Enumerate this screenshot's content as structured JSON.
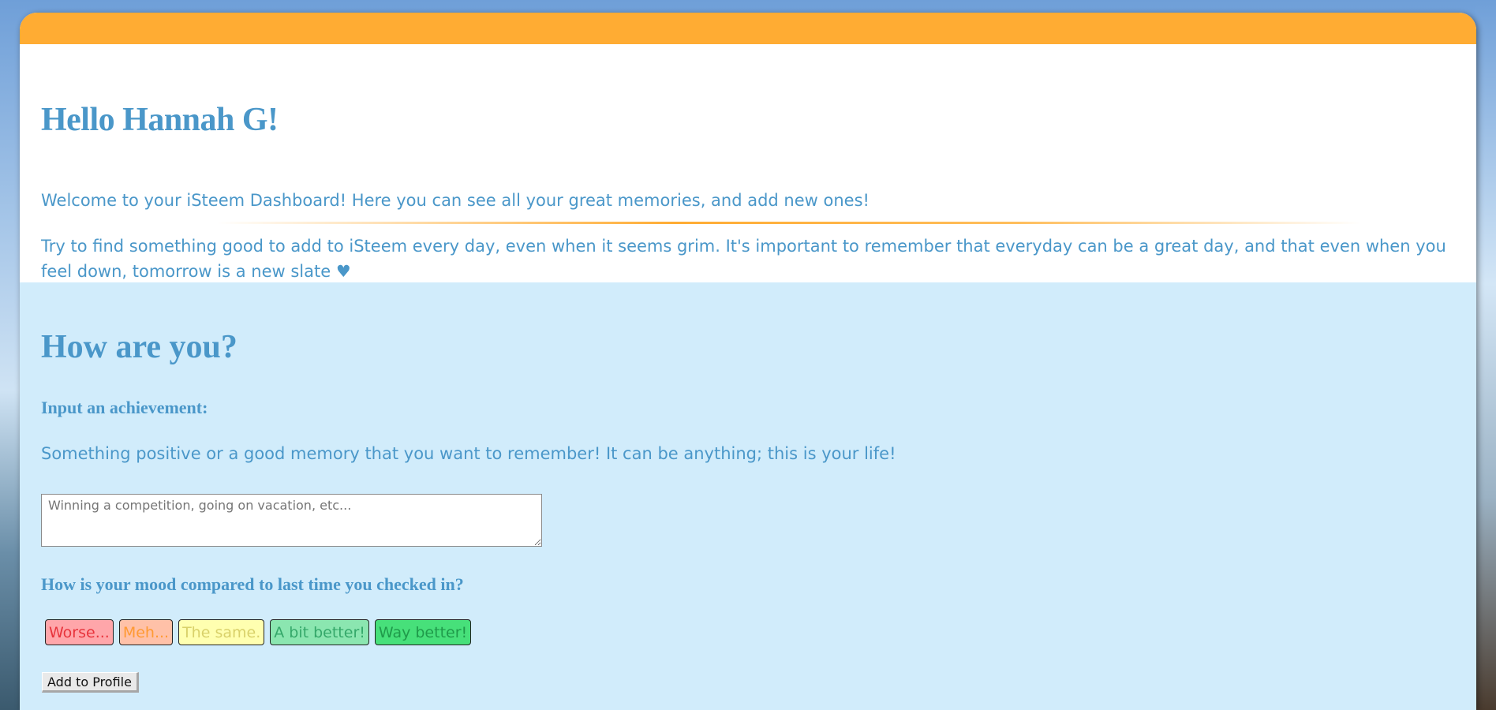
{
  "header": {
    "greeting": "Hello Hannah G!",
    "welcome": "Welcome to your iSteem Dashboard! Here you can see all your great memories, and add new ones!",
    "reminder": "Try to find something good to add to iSteem every day, even when it seems grim. It's important to remember that everyday can be a great day, and that even when you feel down, tomorrow is a new slate ♥"
  },
  "checkin": {
    "title": "How are you?",
    "achievement_label": "Input an achievement:",
    "achievement_help": "Something positive or a good memory that you want to remember! It can be anything; this is your life!",
    "achievement_placeholder": "Winning a competition, going on vacation, etc...",
    "achievement_value": "",
    "mood_label": "How is your mood compared to last time you checked in?",
    "mood_options": [
      {
        "label": "Worse...",
        "bg": "#ffa6aa",
        "fg": "#e8343c"
      },
      {
        "label": "Meh...",
        "bg": "#ffc1a8",
        "fg": "#ff9a33"
      },
      {
        "label": "The same.",
        "bg": "#ffffb0",
        "fg": "#d9d16a"
      },
      {
        "label": "A bit better!",
        "bg": "#8be6b0",
        "fg": "#35a86a"
      },
      {
        "label": "Way better!",
        "bg": "#47e07a",
        "fg": "#1f9a4a"
      }
    ],
    "submit_label": "Add to Profile"
  },
  "colors": {
    "accent_orange": "#ffac33",
    "text_blue": "#4a97c9",
    "section_bg": "#d1ecfb"
  }
}
